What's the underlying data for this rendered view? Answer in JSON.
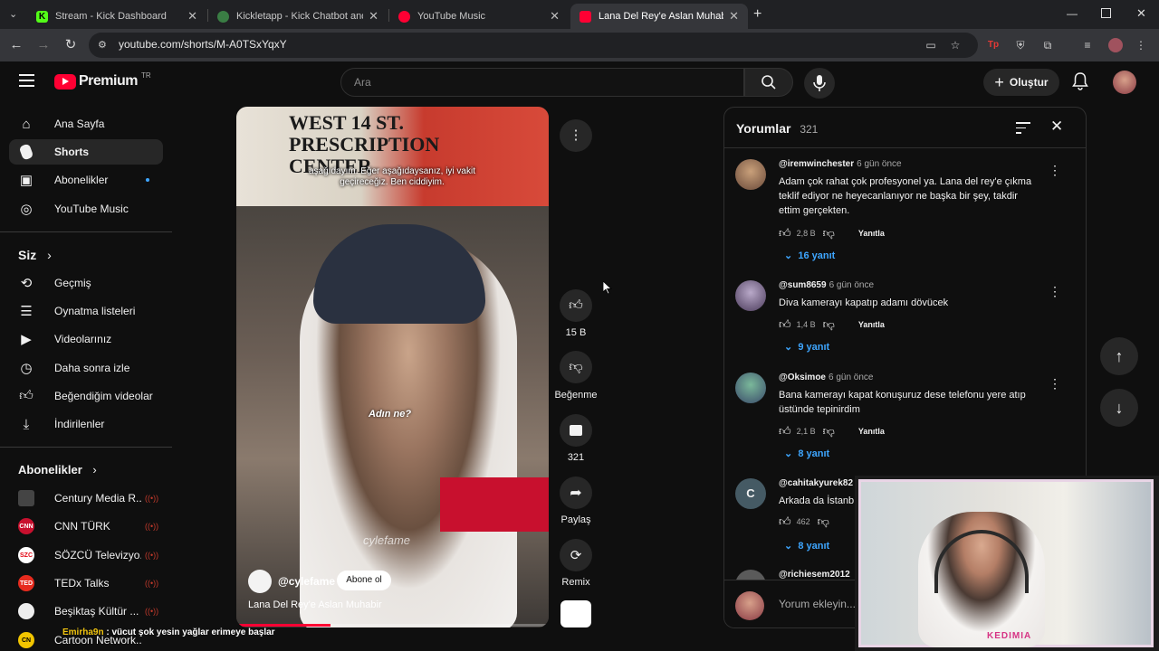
{
  "browser": {
    "tabs": [
      {
        "title": "Stream - Kick Dashboard",
        "color": "#53fc18"
      },
      {
        "title": "Kickletapp - Kick Chatbot and",
        "color": "#3a7d44"
      },
      {
        "title": "YouTube Music",
        "color": "#ff0033"
      },
      {
        "title": "Lana Del Rey'e Aslan Muhabir",
        "color": "#ff0033"
      }
    ],
    "url": "youtube.com/shorts/M-A0TSxYqxY"
  },
  "header": {
    "logo": "Premium",
    "region": "TR",
    "search_placeholder": "Ara",
    "create_label": "Oluştur"
  },
  "sidebar": {
    "main": [
      {
        "label": "Ana Sayfa",
        "icon": "home-icon"
      },
      {
        "label": "Shorts",
        "icon": "shorts-icon"
      },
      {
        "label": "Abonelikler",
        "icon": "subscriptions-icon"
      },
      {
        "label": "YouTube Music",
        "icon": "music-icon"
      }
    ],
    "you_heading": "Siz",
    "you": [
      {
        "label": "Geçmiş",
        "icon": "history-icon"
      },
      {
        "label": "Oynatma listeleri",
        "icon": "playlist-icon"
      },
      {
        "label": "Videolarınız",
        "icon": "your-videos-icon"
      },
      {
        "label": "Daha sonra izle",
        "icon": "watch-later-icon"
      },
      {
        "label": "Beğendiğim videolar",
        "icon": "liked-icon"
      },
      {
        "label": "İndirilenler",
        "icon": "download-icon"
      }
    ],
    "subs_heading": "Abonelikler",
    "subs": [
      {
        "name": "Century Media R...",
        "color": "#444444",
        "badge": ""
      },
      {
        "name": "CNN TÜRK",
        "color": "#c8102e",
        "badge": "CNN"
      },
      {
        "name": "SÖZCÜ Televizyo...",
        "color": "#e30613",
        "badge": "SZC"
      },
      {
        "name": "TEDx Talks",
        "color": "#e62b1e",
        "badge": "TED"
      },
      {
        "name": "Beşiktaş Kültür ...",
        "color": "#eeeeee",
        "badge": ""
      },
      {
        "name": "Cartoon Network...",
        "color": "#f2c500",
        "badge": "CN"
      }
    ]
  },
  "video": {
    "subtitle": "aşağıdayım.  Eğer aşağıdaysanız, iyi vakit geçireceğiz.  Ben ciddiyim.",
    "caption": "Adın ne?",
    "watermark": "cylefame",
    "channel": "@cylefame",
    "subscribe": "Abone ol",
    "title": "Lana Del Rey'e Aslan Muhabir",
    "progress": 0.3
  },
  "actions": {
    "likes": "15 B",
    "dislike": "Beğenme",
    "comments": "321",
    "share": "Paylaş",
    "remix": "Remix"
  },
  "comments": {
    "title": "Yorumlar",
    "count": "321",
    "placeholder": "Yorum ekleyin...",
    "reply_label": "Yanıtla",
    "items": [
      {
        "user": "@iremwinchester",
        "time": "6 gün önce",
        "text": "Adam çok rahat çok profesyonel ya. Lana del rey'e çıkma teklif ediyor ne heyecanlanıyor ne başka bir şey, takdir ettim gerçekten.",
        "likes": "2,8 B",
        "replies": "16 yanıt",
        "color": "#8a6a4a"
      },
      {
        "user": "@sum8659",
        "time": "6 gün önce",
        "text": "Diva kamerayı kapatıp adamı dövücek",
        "likes": "1,4 B",
        "replies": "9 yanıt",
        "color": "#7a6a8a"
      },
      {
        "user": "@Oksimoe",
        "time": "6 gün önce",
        "text": "Bana kamerayı kapat konuşuruz dese telefonu yere atıp üstünde tepinirdim",
        "likes": "2,1 B",
        "replies": "8 yanıt",
        "color": "#4a7a6a"
      },
      {
        "user": "@cahitakyurek82",
        "time": "",
        "text": "Arkada da İstanb",
        "likes": "462",
        "replies": "8 yanıt",
        "color": "#455a64",
        "initial": "C"
      },
      {
        "user": "@richiesem2012",
        "time": "",
        "text": "",
        "likes": "",
        "replies": "",
        "color": "#5a5a5a"
      }
    ]
  },
  "stream": {
    "overlay_name": "KEDIMIA",
    "chat_user": "Emirha9n",
    "chat_text": ": vücut şok yesin yağlar erimeye başlar"
  }
}
